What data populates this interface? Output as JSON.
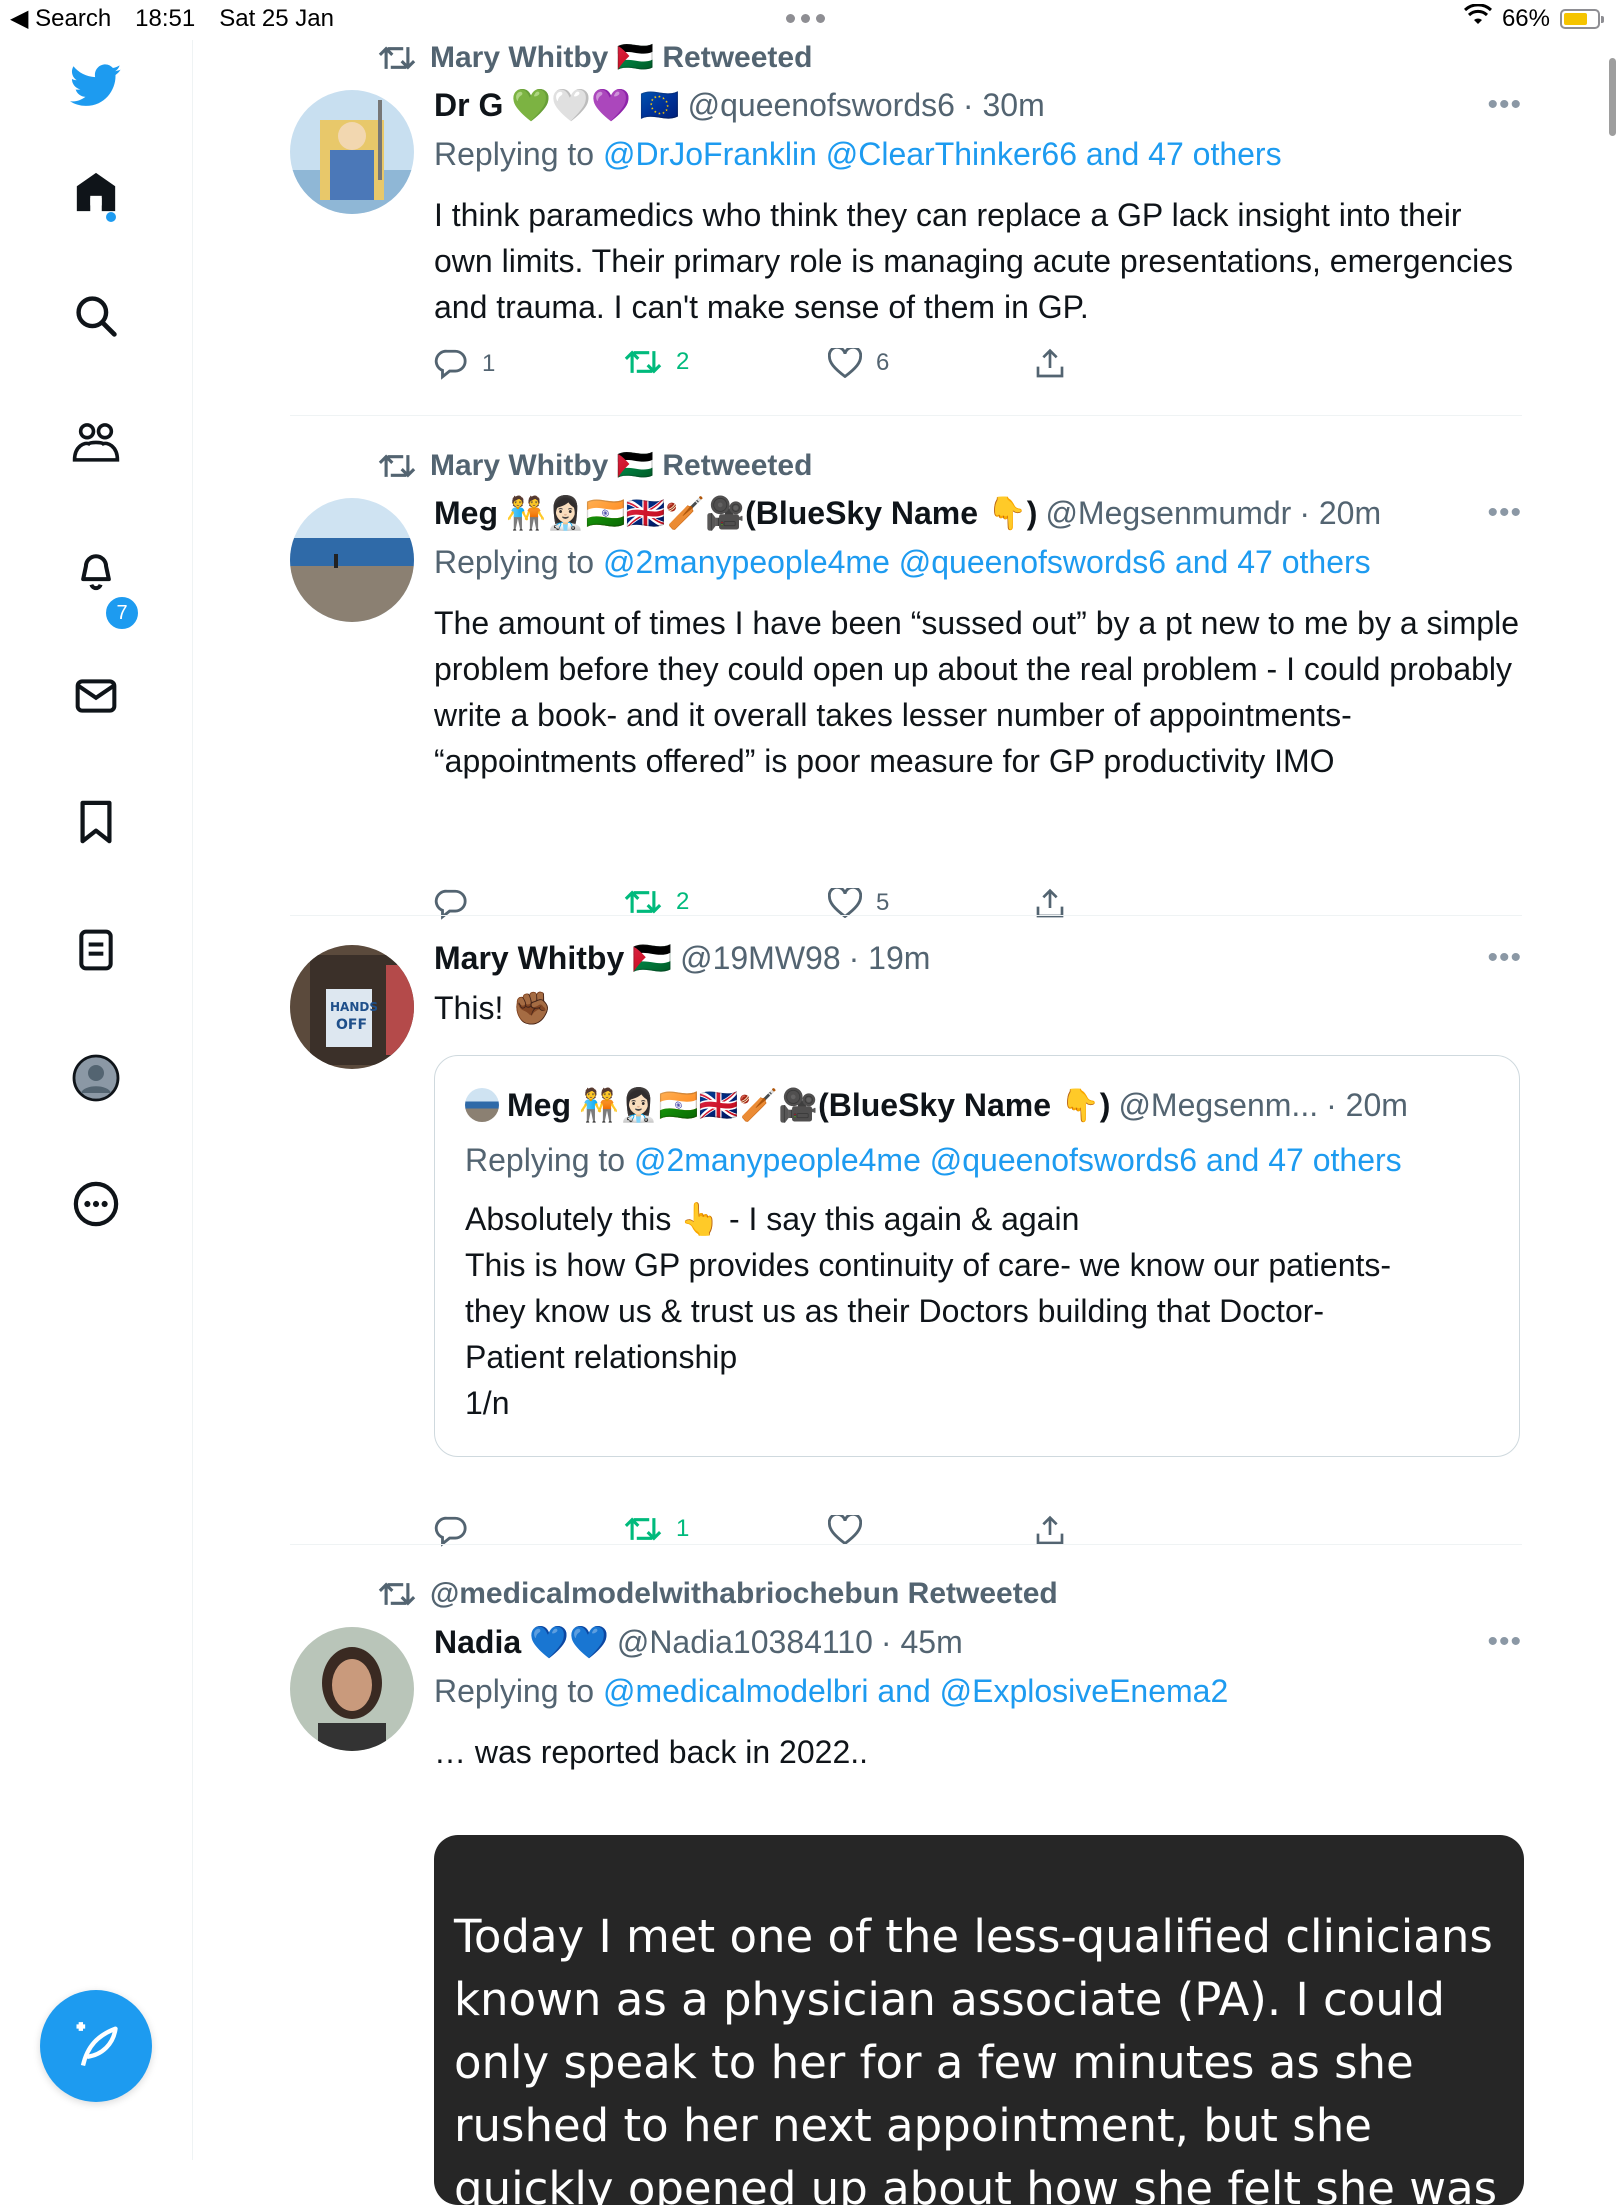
{
  "status_bar": {
    "back_label": "◀ Search",
    "time": "18:51",
    "date": "Sat 25 Jan",
    "battery_percent": "66%",
    "battery_level": 0.66
  },
  "sidebar": {
    "icons": [
      "twitter-bird-icon",
      "home-icon",
      "search-icon",
      "communities-icon",
      "notifications-icon",
      "messages-icon",
      "bookmarks-icon",
      "lists-icon",
      "profile-icon",
      "more-icon"
    ],
    "notification_count": "7",
    "accent": "#1d9bf0"
  },
  "tweets": [
    {
      "retweeted_by": "Mary Whitby 🇵🇸 Retweeted",
      "name": "Dr G",
      "name_emoji": "💚🤍💜 🇪🇺",
      "handle": "@queenofswords6",
      "time": "· 30m",
      "replying_prefix": "Replying to",
      "replying_to": "@DrJoFranklin @ClearThinker66 and 47 others",
      "text": "I think paramedics who think they can replace a GP lack insight into their own limits. Their primary role is managing acute presentations, emergencies and trauma. I can't make sense of them in GP.",
      "replies": "1",
      "retweets": "2",
      "likes": "6"
    },
    {
      "retweeted_by": "Mary Whitby 🇵🇸 Retweeted",
      "name": "Meg",
      "name_emoji": "🧑‍🤝‍🧑👩🏻‍⚕️🇮🇳🇬🇧🏏🎥(BlueSky Name 👇)",
      "handle": "@Megsenmumdr",
      "time": "· 20m",
      "replying_prefix": "Replying to",
      "replying_to": "@2manypeople4me @queenofswords6 and 47 others",
      "text": "The amount of times I have been “sussed out” by a pt new to me by a simple problem before they could open up about the real problem - I could probably write a book- and it overall takes lesser number of appointments- “appointments offered” is poor measure for GP productivity IMO",
      "replies": "",
      "retweets": "2",
      "likes": "5"
    },
    {
      "name": "Mary Whitby",
      "name_emoji": "🇵🇸",
      "handle": "@19MW98",
      "time": "· 19m",
      "text": "This! ✊🏾",
      "quote": {
        "name": "Meg",
        "name_emoji": "🧑‍🤝‍🧑👩🏻‍⚕️🇮🇳🇬🇧🏏🎥(BlueSky Name 👇)",
        "handle": "@Megsenm...",
        "time": "· 20m",
        "replying_prefix": "Replying to",
        "replying_to": "@2manypeople4me @queenofswords6 and 47 others",
        "text_lines": [
          "Absolutely this 👆 - I say this again & again",
          "This is how GP provides continuity of care- we know our patients-",
          "they know us & trust us as their Doctors building that Doctor-",
          "Patient relationship",
          "1/n"
        ]
      },
      "replies": "",
      "retweets": "1",
      "likes": ""
    },
    {
      "retweeted_by": "@medicalmodelwithabriochebun Retweeted",
      "name": "Nadia",
      "name_emoji": "💙💙",
      "handle": "@Nadia10384110",
      "time": "· 45m",
      "replying_prefix": "Replying to",
      "replying_to": "@medicalmodelbri and @ExplosiveEnema2",
      "text": "… was reported back in 2022..",
      "image_text": "Today I met one of the less-qualified clinicians known as a physician associate (PA). I could only speak to her for a few minutes as she rushed to her next appointment, but she quickly opened up about how she felt she was being treated exactly like a"
    }
  ]
}
